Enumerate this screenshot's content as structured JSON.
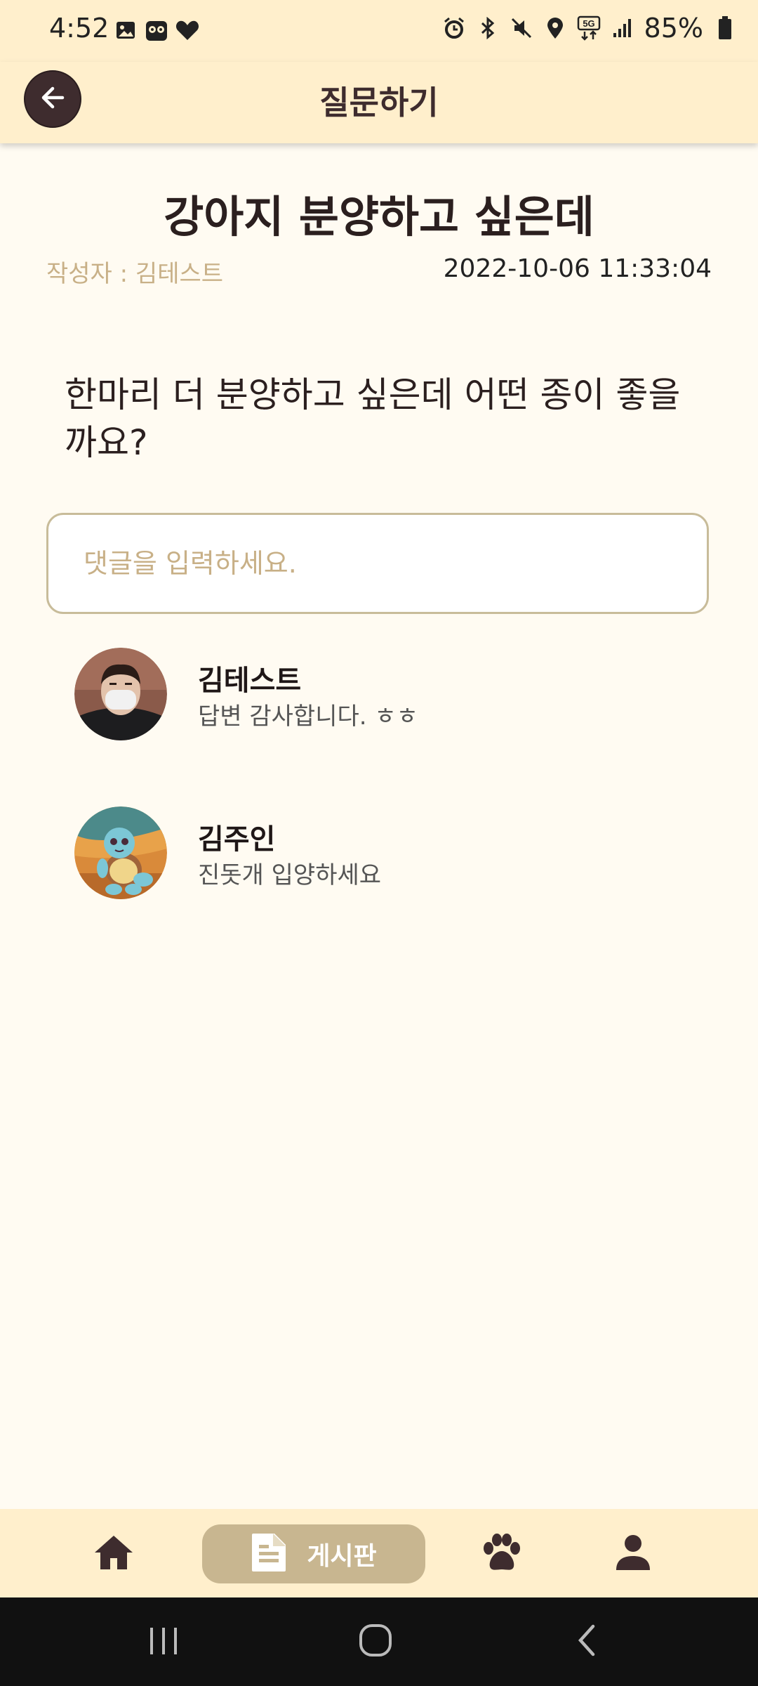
{
  "status_bar": {
    "time": "4:52",
    "battery": "85%",
    "left_icons": [
      "image-icon",
      "app-icon",
      "heart-icon"
    ],
    "right_icons": [
      "alarm-icon",
      "bluetooth-icon",
      "mute-icon",
      "location-icon",
      "5g-icon",
      "signal-icon",
      "battery-icon"
    ]
  },
  "app_bar": {
    "title": "질문하기",
    "back_icon": "arrow-left-icon"
  },
  "post": {
    "title": "강아지 분양하고 싶은데",
    "author": "작성자 : 김테스트",
    "date": "2022-10-06 11:33:04",
    "body": "한마리 더 분양하고 싶은데 어떤 종이 좋을까요?"
  },
  "comment_input": {
    "placeholder": "댓글을 입력하세요."
  },
  "comments": [
    {
      "name": "김테스트",
      "text": "답변 감사합니다. ㅎㅎ",
      "avatar": "person-photo"
    },
    {
      "name": "김주인",
      "text": "진돗개 입양하세요",
      "avatar": "turtle-character"
    }
  ],
  "bottom_nav": {
    "items": [
      {
        "icon": "home-icon",
        "label": ""
      },
      {
        "icon": "document-icon",
        "label": "게시판",
        "active": true
      },
      {
        "icon": "paw-icon",
        "label": ""
      },
      {
        "icon": "person-icon",
        "label": ""
      }
    ]
  },
  "colors": {
    "bar_background": "#FFEFCC",
    "page_background": "#FFFBF2",
    "active_tab": "#C8B690",
    "accent_dark": "#3E2C2E",
    "muted_text": "#C8B087"
  }
}
